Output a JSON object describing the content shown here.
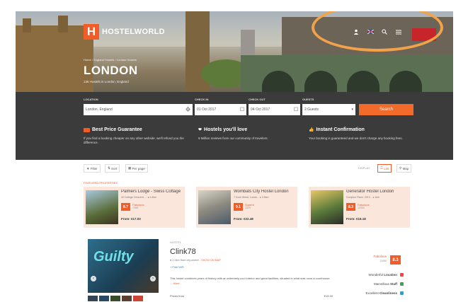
{
  "brand": {
    "mark": "H",
    "name": "HOSTELWORLD",
    "color": "#f25c27"
  },
  "hero": {
    "breadcrumb": "Home  ›  England Hostels  ›  London Hostels",
    "city": "LONDON",
    "subtitle": "136 Hostels in London, England",
    "top_icons": [
      "user-icon",
      "flag-icon",
      "search-icon",
      "menu-icon"
    ]
  },
  "search": {
    "location_label": "LOCATION",
    "location_value": "London, England",
    "checkin_label": "CHECK IN",
    "checkin_value": "01 Oct 2017",
    "checkout_label": "CHECK OUT",
    "checkout_value": "04 Oct 2017",
    "guests_label": "GUESTS",
    "guests_value": "2 Guests",
    "button": "Search"
  },
  "features": [
    {
      "title": "Best Price Guarantee",
      "desc": "If you find a booking cheaper on any other website, we'll refund you the difference."
    },
    {
      "title": "Hostels you'll love",
      "desc": "9 Million reviews from our community of travelers."
    },
    {
      "title": "Instant Confirmation",
      "desc": "Your booking is guaranteed and we don't charge any booking fees."
    }
  ],
  "toolbar": {
    "filter": "Filter",
    "sort": "Sort",
    "per_page": "Per page",
    "display": "DISPLAY",
    "list": "List",
    "map": "Map"
  },
  "featured_label": "FEATURED PROPERTIES",
  "featured": [
    {
      "name": "Palmers Lodge - Swiss Cottage",
      "address": "40 College Crescent, ... ● 4.4km",
      "rating": "8.7",
      "rating_word": "Fabulous",
      "reviews": "7088",
      "price": "From: €17.03"
    },
    {
      "name": "Wombats City Hostel London",
      "address": "7 Dock Street, Londo... ● 3.5km",
      "rating": "9.1",
      "rating_word": "Superb",
      "reviews": "4329",
      "price": "From: €22.48"
    },
    {
      "name": "Generator Hostel London",
      "address": "Compton Place, Off 3... ● 1km",
      "rating": "8.3",
      "rating_word": "Fabulous",
      "reviews": "12994",
      "price": "From: €16.18"
    }
  ],
  "listing": {
    "type": "HOSTEL",
    "name": "Clink78",
    "address": "● 2.2km from city centre - ",
    "show_on_map": "SHOW ON MAP",
    "wifi": "Free WiFi",
    "description": "This hostel combines years of history with an extremely cool interior and great facilities, situated in what was once a courthouse.",
    "more": "More",
    "prices_from": "Prices from",
    "price": "€15.30",
    "rating": "8.3",
    "rating_word": "Fabulous",
    "reviews": "13465",
    "image_text": "Guilty",
    "attributes": [
      {
        "label": "Wonderful",
        "bold": "Location",
        "color": "#e8474c"
      },
      {
        "label": "Marvellous",
        "bold": "Staff",
        "color": "#3aa556"
      },
      {
        "label": "Excellent",
        "bold": "Cleanliness",
        "color": "#2a9fd0"
      }
    ]
  }
}
